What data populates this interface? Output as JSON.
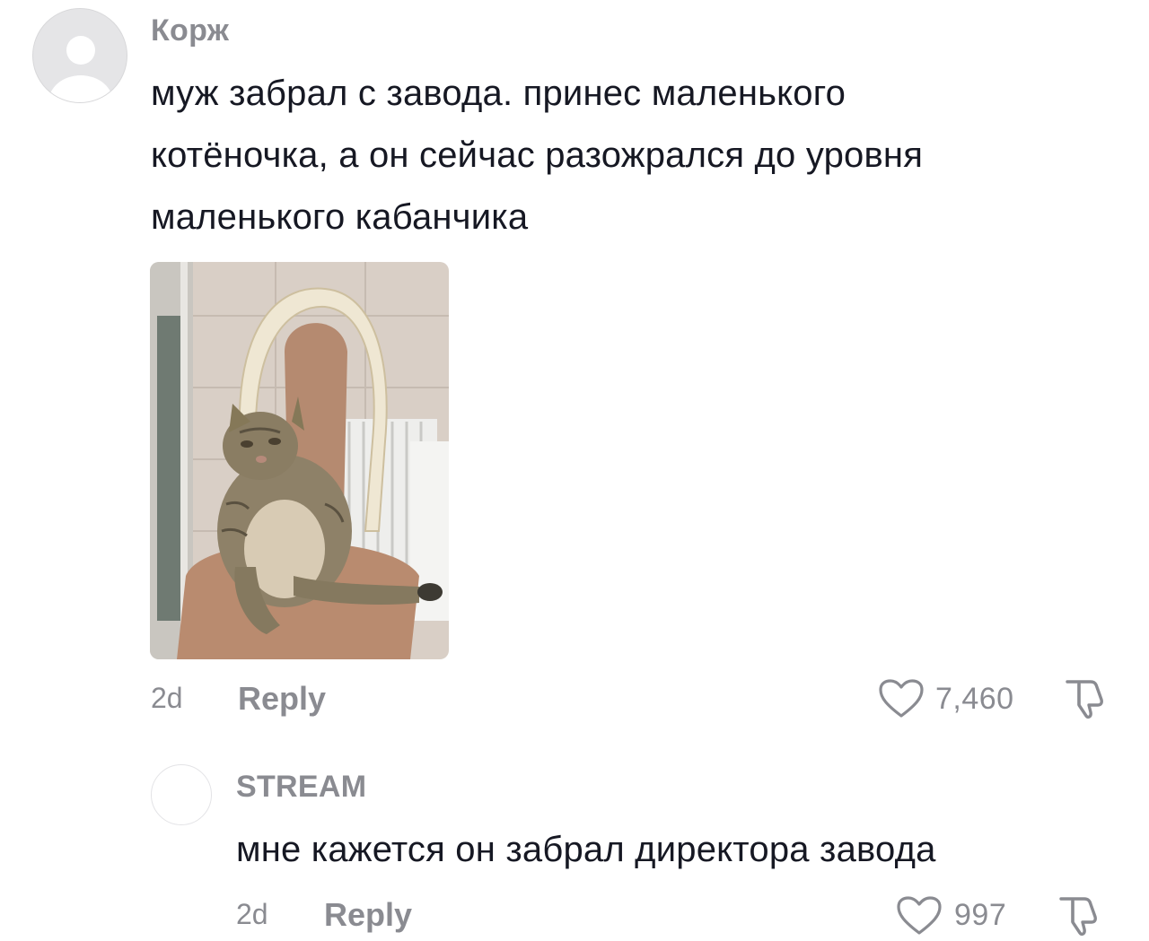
{
  "comment": {
    "username": "Корж",
    "text": "муж забрал с завода. принес маленького\nкотёночка, а он сейчас разожрался до уровня\nмаленького кабанчика",
    "time": "2d",
    "reply_label": "Reply",
    "likes": "7,460",
    "avatar_icon": "default-avatar-icon",
    "like_icon": "heart-outline-icon",
    "dislike_icon": "thumbs-down-icon"
  },
  "reply": {
    "username": "STREAM",
    "text": "мне кажется он забрал директора завода",
    "time": "2d",
    "reply_label": "Reply",
    "likes": "997",
    "like_icon": "heart-outline-icon",
    "dislike_icon": "thumbs-down-icon"
  },
  "colors": {
    "text_primary": "#161823",
    "text_secondary": "#8a8b91",
    "background": "#ffffff"
  }
}
